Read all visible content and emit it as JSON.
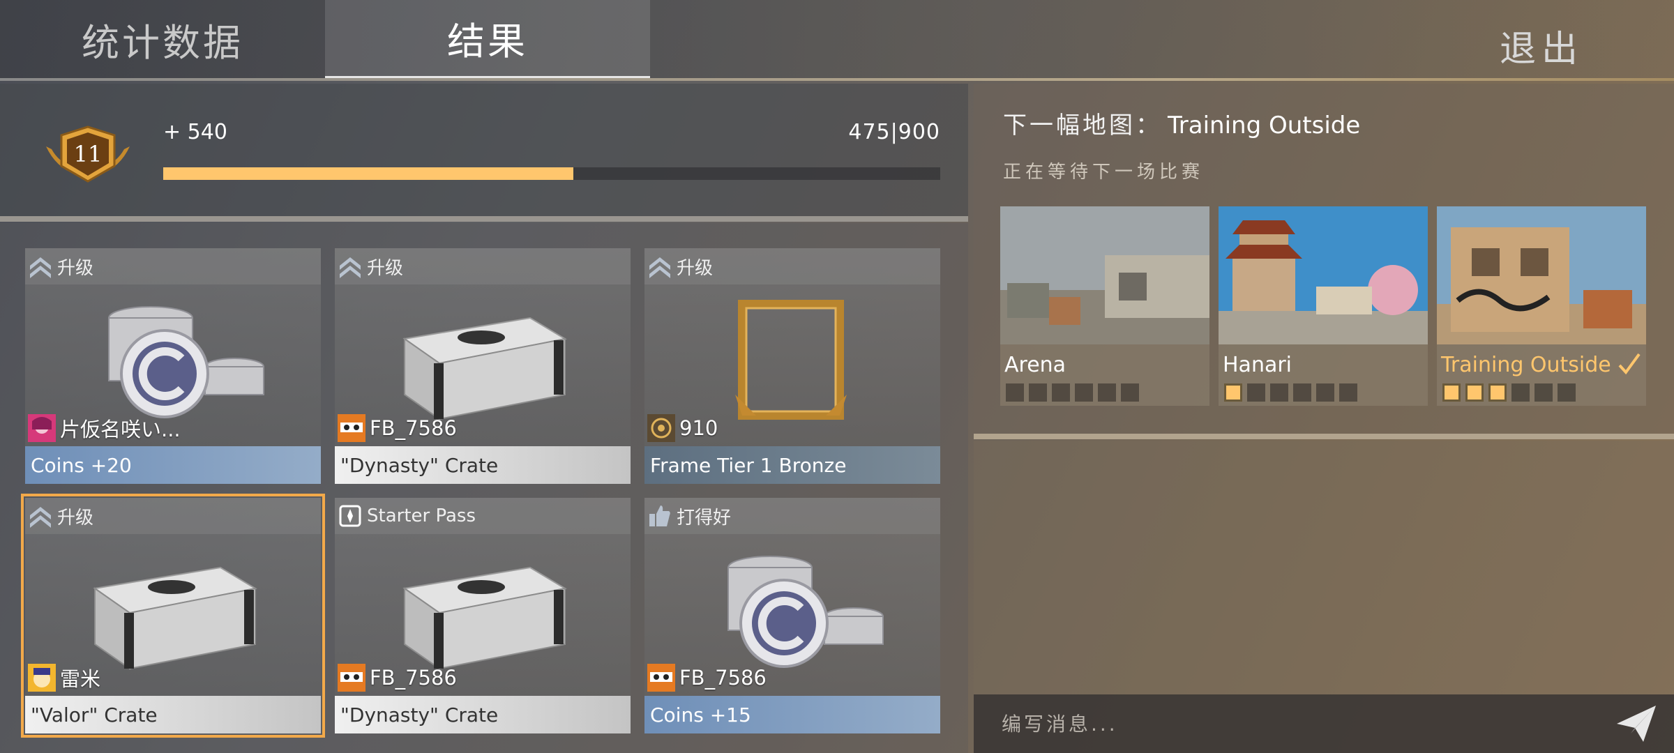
{
  "tabs": {
    "stats": "统计数据",
    "results": "结果"
  },
  "exit_label": "退出",
  "progress": {
    "level": "11",
    "gain": "+ 540",
    "count": "475|900",
    "fraction": 0.5278
  },
  "cards": [
    {
      "tag": "升级",
      "tag_icon": "rank-chevron-icon",
      "user": "片仮名咲い...",
      "avatar": "anime-avatar",
      "item": "Coins +20",
      "kind": "coins",
      "selected": false
    },
    {
      "tag": "升级",
      "tag_icon": "rank-chevron-icon",
      "user": "FB_7586",
      "avatar": "tiger-avatar",
      "item": "\"Dynasty\" Crate",
      "kind": "crate",
      "selected": false
    },
    {
      "tag": "升级",
      "tag_icon": "rank-chevron-icon",
      "user": "910",
      "avatar": "target-avatar",
      "item": "Frame Tier 1 Bronze",
      "kind": "frame",
      "selected": false
    },
    {
      "tag": "升级",
      "tag_icon": "rank-chevron-icon",
      "user": "雷米",
      "avatar": "cartoon-avatar",
      "item": "\"Valor\" Crate",
      "kind": "crate",
      "selected": true
    },
    {
      "tag": "Starter Pass",
      "tag_icon": "pass-icon",
      "user": "FB_7586",
      "avatar": "tiger-avatar",
      "item": "\"Dynasty\" Crate",
      "kind": "crate",
      "selected": false
    },
    {
      "tag": "打得好",
      "tag_icon": "thumbs-up-icon",
      "user": "FB_7586",
      "avatar": "tiger-avatar",
      "item": "Coins +15",
      "kind": "coins",
      "selected": false
    }
  ],
  "next_map": {
    "label": "下一幅地图：",
    "name": "Training Outside",
    "waiting": "正在等待下一场比赛"
  },
  "maps": [
    {
      "name": "Arena",
      "votes": 0,
      "total": 6,
      "chosen": false
    },
    {
      "name": "Hanari",
      "votes": 1,
      "total": 6,
      "chosen": false
    },
    {
      "name": "Training Outside",
      "votes": 3,
      "total": 6,
      "chosen": true
    }
  ],
  "chat": {
    "placeholder": "编写消息..."
  },
  "colors": {
    "accent": "#ffc66d",
    "selected_outline": "#f2a94a",
    "coins_footer": "#6f8fb8",
    "frame_footer": "#5d6f80"
  }
}
